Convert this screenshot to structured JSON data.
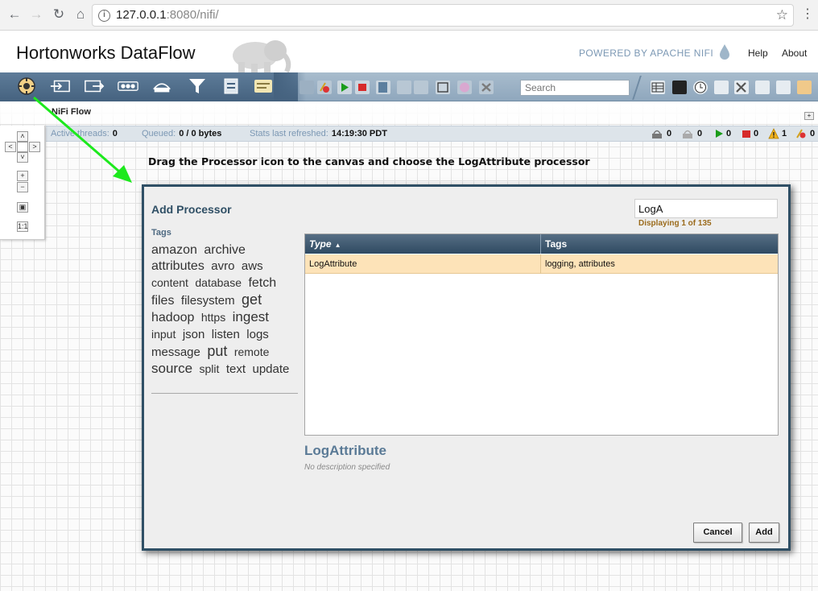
{
  "browser": {
    "url_host": "127.0.0.1",
    "url_rest": ":8080/nifi/"
  },
  "header": {
    "brand": "Hortonworks DataFlow",
    "powered_by": "POWERED BY APACHE NIFI",
    "help": "Help",
    "about": "About"
  },
  "toolbar": {
    "search_placeholder": "Search"
  },
  "flow": {
    "name": "NiFi Flow"
  },
  "status": {
    "active_threads_label": "Active threads:",
    "active_threads": "0",
    "queued_label": "Queued:",
    "queued": "0 / 0 bytes",
    "refreshed_label": "Stats last refreshed:",
    "refreshed": "14:19:30 PDT",
    "counts": {
      "transmitting": "0",
      "not_transmitting": "0",
      "running": "0",
      "stopped": "0",
      "invalid": "1",
      "disabled": "0"
    }
  },
  "instruction": "Drag the Processor icon to the canvas and choose the LogAttribute processor",
  "dialog": {
    "title": "Add Processor",
    "search_value": "LogA",
    "displaying": "Displaying 1 of 135",
    "tags_label": "Tags",
    "tags": [
      {
        "t": "amazon",
        "s": 16
      },
      {
        "t": "archive",
        "s": 16
      },
      {
        "t": "attributes",
        "s": 16
      },
      {
        "t": "avro",
        "s": 15
      },
      {
        "t": "aws",
        "s": 15
      },
      {
        "t": "content",
        "s": 14
      },
      {
        "t": "database",
        "s": 14
      },
      {
        "t": "fetch",
        "s": 16
      },
      {
        "t": "files",
        "s": 16
      },
      {
        "t": "filesystem",
        "s": 15
      },
      {
        "t": "get",
        "s": 18
      },
      {
        "t": "hadoop",
        "s": 16
      },
      {
        "t": "https",
        "s": 14
      },
      {
        "t": "ingest",
        "s": 17
      },
      {
        "t": "input",
        "s": 14
      },
      {
        "t": "json",
        "s": 15
      },
      {
        "t": "listen",
        "s": 15
      },
      {
        "t": "logs",
        "s": 15
      },
      {
        "t": "message",
        "s": 15
      },
      {
        "t": "put",
        "s": 18
      },
      {
        "t": "remote",
        "s": 14
      },
      {
        "t": "source",
        "s": 17
      },
      {
        "t": "split",
        "s": 14
      },
      {
        "t": "text",
        "s": 15
      },
      {
        "t": "update",
        "s": 15
      }
    ],
    "table": {
      "col_type": "Type",
      "col_tags": "Tags",
      "rows": [
        {
          "type": "LogAttribute",
          "tags": "logging, attributes"
        }
      ]
    },
    "selected_name": "LogAttribute",
    "selected_desc": "No description specified",
    "cancel": "Cancel",
    "add": "Add"
  },
  "colors": {
    "toolbar_dark": "#45627f",
    "dialog_border": "#2f4f65",
    "selected_row": "#fde3b8",
    "arrow": "#1de91d"
  }
}
